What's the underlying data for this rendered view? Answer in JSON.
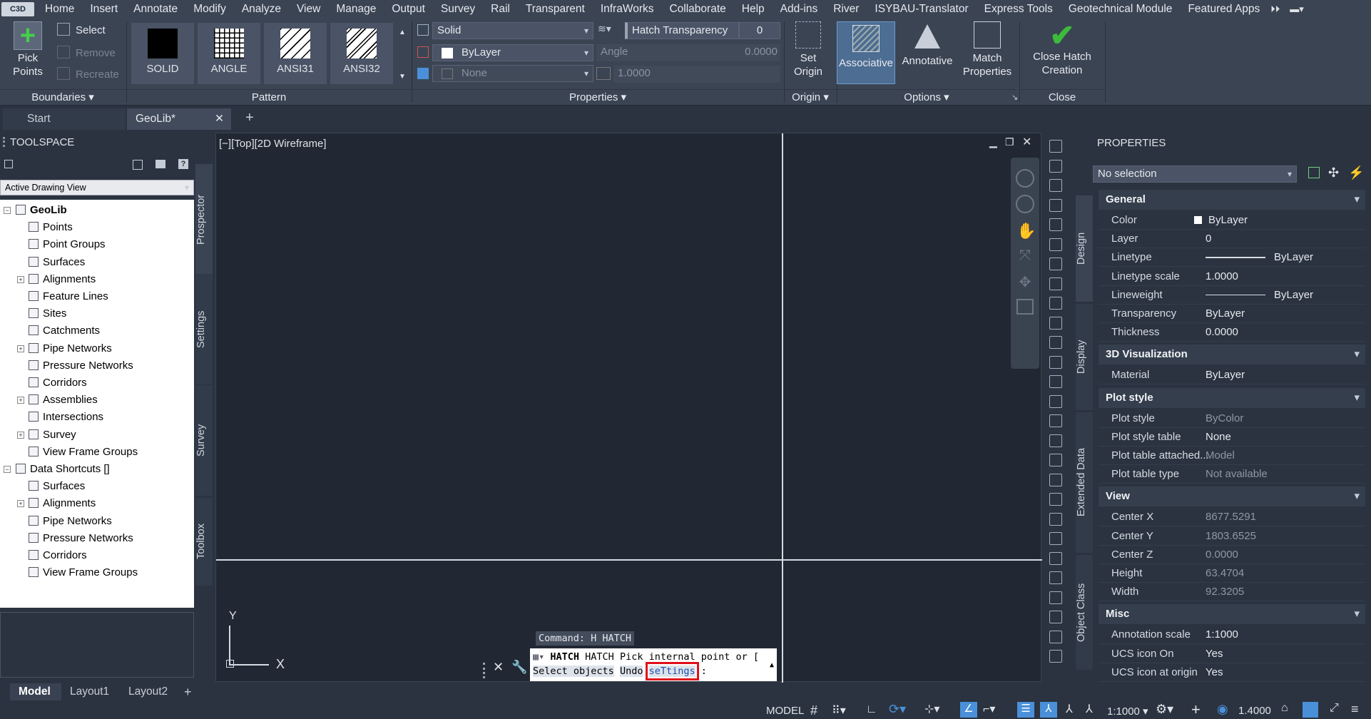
{
  "app_logo": "C3D",
  "menu": [
    "Home",
    "Insert",
    "Annotate",
    "Modify",
    "Analyze",
    "View",
    "Manage",
    "Output",
    "Survey",
    "Rail",
    "Transparent",
    "InfraWorks",
    "Collaborate",
    "Help",
    "Add-ins",
    "River",
    "ISYBAU-Translator",
    "Express Tools",
    "Geotechnical Module",
    "Featured Apps"
  ],
  "ribbon": {
    "boundaries": {
      "title": "Boundaries ▾",
      "pick_points": "Pick Points",
      "select": "Select",
      "remove": "Remove",
      "recreate": "Recreate"
    },
    "pattern": {
      "title": "Pattern",
      "items": [
        "SOLID",
        "ANGLE",
        "ANSI31",
        "ANSI32"
      ]
    },
    "properties": {
      "title": "Properties ▾",
      "type_value": "Solid",
      "color_value": "ByLayer",
      "background_value": "None",
      "transparency_label": "Hatch Transparency",
      "transparency_value": "0",
      "angle_label": "Angle",
      "angle_value": "0.0000",
      "scale_value": "1.0000"
    },
    "origin": {
      "title": "Origin ▾",
      "set_origin": "Set Origin"
    },
    "options": {
      "title": "Options ▾",
      "associative": "Associative",
      "annotative": "Annotative",
      "match_properties": "Match Properties"
    },
    "close": {
      "title": "Close",
      "close_label": "Close Hatch Creation"
    }
  },
  "doc_tabs": {
    "start": "Start",
    "active": "GeoLib*",
    "add": "+",
    "close": "✕"
  },
  "toolspace": {
    "title": "TOOLSPACE",
    "view_select": "Active Drawing View",
    "tree": [
      {
        "label": "GeoLib",
        "level": 0,
        "bold": true,
        "exp": "⊟"
      },
      {
        "label": "Points",
        "level": 1
      },
      {
        "label": "Point Groups",
        "level": 1
      },
      {
        "label": "Surfaces",
        "level": 1
      },
      {
        "label": "Alignments",
        "level": 1,
        "exp": "⊞"
      },
      {
        "label": "Feature Lines",
        "level": 1
      },
      {
        "label": "Sites",
        "level": 1
      },
      {
        "label": "Catchments",
        "level": 1
      },
      {
        "label": "Pipe Networks",
        "level": 1,
        "exp": "⊞"
      },
      {
        "label": "Pressure Networks",
        "level": 1
      },
      {
        "label": "Corridors",
        "level": 1
      },
      {
        "label": "Assemblies",
        "level": 1,
        "exp": "⊞"
      },
      {
        "label": "Intersections",
        "level": 1
      },
      {
        "label": "Survey",
        "level": 1,
        "exp": "⊞"
      },
      {
        "label": "View Frame Groups",
        "level": 1
      },
      {
        "label": "Data Shortcuts []",
        "level": 0,
        "exp": "⊟"
      },
      {
        "label": "Surfaces",
        "level": 1
      },
      {
        "label": "Alignments",
        "level": 1,
        "exp": "⊞"
      },
      {
        "label": "Pipe Networks",
        "level": 1
      },
      {
        "label": "Pressure Networks",
        "level": 1
      },
      {
        "label": "Corridors",
        "level": 1
      },
      {
        "label": "View Frame Groups",
        "level": 1
      }
    ],
    "vtabs": [
      "Prospector",
      "Settings",
      "Survey",
      "Toolbox"
    ]
  },
  "viewport": {
    "label": "[−][Top][2D Wireframe]",
    "ucs_x": "X",
    "ucs_y": "Y",
    "command_history": "Command: H HATCH",
    "command_line1": "HATCH Pick internal point or [",
    "command_opt1": "Select objects",
    "command_opt2": "Undo",
    "command_opt3": "seTtings",
    "command_end": "]:"
  },
  "properties": {
    "title": "PROPERTIES",
    "selection": "No selection",
    "vtabs": [
      "Design",
      "Display",
      "Extended Data",
      "Object Class"
    ],
    "sections": [
      {
        "name": "General",
        "rows": [
          [
            "Color",
            "ByLayer",
            false
          ],
          [
            "Layer",
            "0",
            false
          ],
          [
            "Linetype",
            "ByLayer",
            false
          ],
          [
            "Linetype scale",
            "1.0000",
            false
          ],
          [
            "Lineweight",
            "ByLayer",
            false
          ],
          [
            "Transparency",
            "ByLayer",
            false
          ],
          [
            "Thickness",
            "0.0000",
            false
          ]
        ]
      },
      {
        "name": "3D Visualization",
        "rows": [
          [
            "Material",
            "ByLayer",
            false
          ]
        ]
      },
      {
        "name": "Plot style",
        "rows": [
          [
            "Plot style",
            "ByColor",
            true
          ],
          [
            "Plot style table",
            "None",
            false
          ],
          [
            "Plot table attached...",
            "Model",
            true
          ],
          [
            "Plot table type",
            "Not available",
            true
          ]
        ]
      },
      {
        "name": "View",
        "rows": [
          [
            "Center X",
            "8677.5291",
            true
          ],
          [
            "Center Y",
            "1803.6525",
            true
          ],
          [
            "Center Z",
            "0.0000",
            true
          ],
          [
            "Height",
            "63.4704",
            true
          ],
          [
            "Width",
            "92.3205",
            true
          ]
        ]
      },
      {
        "name": "Misc",
        "rows": [
          [
            "Annotation scale",
            "1:1000",
            false
          ],
          [
            "UCS icon On",
            "Yes",
            false
          ],
          [
            "UCS icon at origin",
            "Yes",
            false
          ]
        ]
      }
    ]
  },
  "status": {
    "model_tab": "Model",
    "layout1": "Layout1",
    "layout2": "Layout2",
    "add": "+",
    "model_label": "MODEL",
    "scale": "1:1000 ▾",
    "lineweight": "1.4000"
  },
  "colors": {
    "accent": "#4a90d9",
    "highlight_box": "#e0101a",
    "check_green": "#3dbb3a"
  }
}
